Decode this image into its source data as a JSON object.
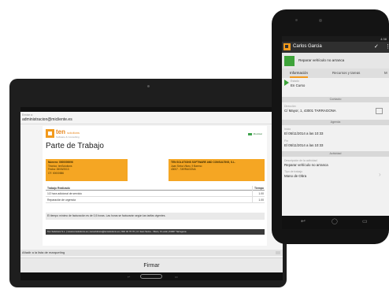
{
  "tablet": {
    "to_label": "Enviar a:",
    "email": "administracion@micliente.es",
    "document": {
      "logo_text": "ten",
      "logo_word": "solutions",
      "logo_sub": "Software & Consulting",
      "brand_right": "Movistar",
      "title": "Parte de Trabajo",
      "left_box": [
        "Número: 0000000096",
        "Técnico: tenSolutions",
        "Fecha: 26/05/2013",
        "OT: 00000586"
      ],
      "right_box": [
        "TEN SOLUTIONS SOFTWARE AND CONSULTING, S.L.",
        "Juan Seiva Vilaro, 9 Bareno",
        "43007 - TARRAGONA"
      ],
      "table": {
        "col_desc": "Trabajo Realizado",
        "col_time": "Tiempo",
        "rows": [
          {
            "desc": "1/2 hora adicional de servicio",
            "time": "1.00"
          },
          {
            "desc": "Reparación de urgencia",
            "time": "1.00"
          }
        ]
      },
      "note": "El tiempo mínimo de facturación es de 0,5 horas. Las horas se facturarán según las tarifas vigentes.",
      "footer": "Ten Solutions S.L. | www.tensolutions.es | tensolutions@tensolutions.es | 902 32 76 70 | C/ Juan Seiva - Vilaro, 9 Local | 43007 Tarragona"
    },
    "add_label": "Añadir a la lista de marquetíng",
    "sign_button": "Firmar"
  },
  "phone": {
    "status_time": "4:38",
    "contact_name": "Carlos Garcia",
    "task": "Reparar vehículo no arranca",
    "tabs": [
      "Información",
      "Recursos y tareas",
      "M"
    ],
    "estado_label": "Estado",
    "estado_value": "En Curso",
    "contacto_header": "Contacto",
    "direccion_label": "Dirección",
    "direccion_value": "C/ Mayor, 1, 43001 TARRAGONA",
    "agenda_header": "Agenda",
    "inicio_label": "Inicio",
    "inicio_value": "El 05/11/2014 a las 10:33",
    "fin_label": "Fin",
    "fin_value": "El 05/11/2014 a las 10:33",
    "actividad_header": "Actividad",
    "descripcion_label": "Descripción de la actividad",
    "descripcion_value": "Reparar vehículo no arranca",
    "tipo_label": "Tipo de trabajo",
    "tipo_value": "Mano de Obra"
  },
  "colors": {
    "accent_orange": "#f29a1d",
    "status_green": "#3ea33a"
  }
}
